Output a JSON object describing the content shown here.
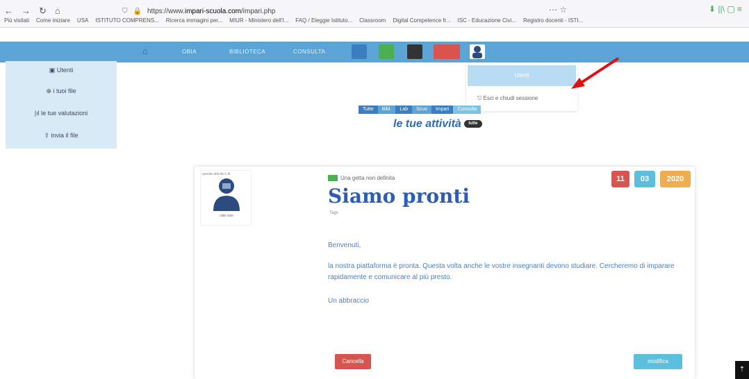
{
  "browser": {
    "back": "←",
    "forward": "→",
    "reload": "↻",
    "home": "⌂",
    "url_prefix": "https://www.",
    "url_domain": "impari-scuola.com",
    "url_suffix": "/impari.php",
    "actions": "⋯  ☆",
    "ext": "⬇  ||\\  ▢  ≡"
  },
  "bookmarks": [
    "Più visitati",
    "Come iniziare",
    "USA",
    "ISTITUTO COMPRENS...",
    "Ricerca immagini per...",
    "MIUR - Ministero dell'I...",
    "FAQ / Eleggie Istituto...",
    "Classroom",
    "Digital Competence fr...",
    "ISC - Educazione Civi...",
    "Registro docenti - ISTI..."
  ],
  "topnav": {
    "home_icon": "home-icon",
    "links": [
      "OBIA",
      "BIBLIOTECA",
      "CONSULTA"
    ]
  },
  "sidebar": {
    "items": [
      "Utenti",
      "i tuoi file",
      "le tue valutazioni",
      "invia il file"
    ]
  },
  "dropdown": {
    "head": "Utenti",
    "logout": "⎋ Esci e chiudi sessione"
  },
  "tabs": [
    "Tutte",
    "Bibl.",
    "Lab",
    "Scuo",
    "Impari",
    "Consulta"
  ],
  "page_title": "le tue attività",
  "title_badge": "tutte",
  "card": {
    "avatar_caption": "questa attività è di",
    "avatar_sub": "ciao ciao",
    "category": "Una getta non definita",
    "headline": "Siamo pronti",
    "sub": "Tags",
    "date_day": "11",
    "date_month": "03",
    "date_year": "2020",
    "p1": "Benvenuti,",
    "p2": "la nostra piattaforma è pronta. Questa volta anche le vostre insegnanti devono studiare. Cercheremo di imparare rapidamente e comunicare al più presto.",
    "p3": "Un abbraccio",
    "btn_delete": "Cancella",
    "btn_edit": "modifica"
  },
  "colors": {
    "navbar": "#5ba5d6",
    "red": "#d9534f",
    "blue": "#5bc0de",
    "orange": "#f0ad4e",
    "headline": "#2a5cb8",
    "arrow": "#e01010"
  }
}
